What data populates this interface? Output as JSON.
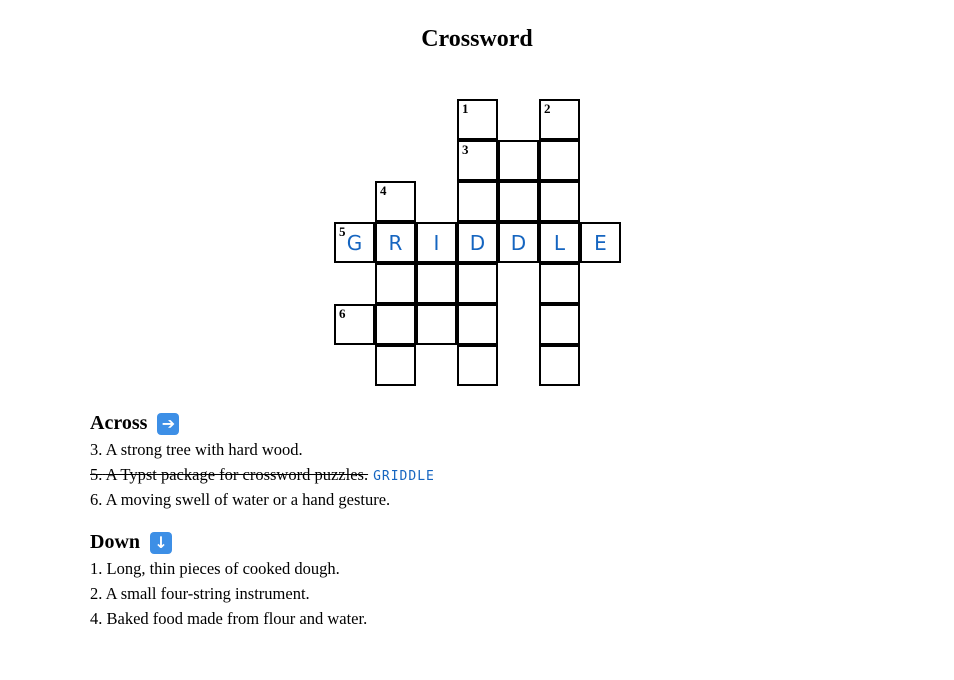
{
  "title": "Crossword",
  "grid": {
    "cells": [
      {
        "row": 0,
        "col": 3,
        "number": "1"
      },
      {
        "row": 0,
        "col": 5,
        "number": "2"
      },
      {
        "row": 1,
        "col": 3,
        "number": "3"
      },
      {
        "row": 1,
        "col": 4
      },
      {
        "row": 1,
        "col": 5
      },
      {
        "row": 2,
        "col": 1,
        "number": "4"
      },
      {
        "row": 2,
        "col": 3
      },
      {
        "row": 2,
        "col": 4
      },
      {
        "row": 2,
        "col": 5
      },
      {
        "row": 3,
        "col": 0,
        "number": "5",
        "letter": "G"
      },
      {
        "row": 3,
        "col": 1,
        "letter": "R"
      },
      {
        "row": 3,
        "col": 2,
        "letter": "I"
      },
      {
        "row": 3,
        "col": 3,
        "letter": "D"
      },
      {
        "row": 3,
        "col": 4,
        "letter": "D"
      },
      {
        "row": 3,
        "col": 5,
        "letter": "L"
      },
      {
        "row": 3,
        "col": 6,
        "letter": "E"
      },
      {
        "row": 4,
        "col": 1
      },
      {
        "row": 4,
        "col": 2
      },
      {
        "row": 4,
        "col": 3
      },
      {
        "row": 4,
        "col": 5
      },
      {
        "row": 5,
        "col": 0,
        "number": "6"
      },
      {
        "row": 5,
        "col": 1
      },
      {
        "row": 5,
        "col": 2
      },
      {
        "row": 5,
        "col": 3
      },
      {
        "row": 5,
        "col": 5
      },
      {
        "row": 6,
        "col": 1
      },
      {
        "row": 6,
        "col": 3
      },
      {
        "row": 6,
        "col": 5
      }
    ]
  },
  "across": {
    "heading": "Across",
    "icon": "right-arrow-icon",
    "icon_glyph": "➔",
    "clues": [
      {
        "number": "3.",
        "text": "A strong tree with hard wood.",
        "solved": false,
        "answer": ""
      },
      {
        "number": "5.",
        "text": "A Typst package for crossword puzzles.",
        "solved": true,
        "answer": "GRIDDLE"
      },
      {
        "number": "6.",
        "text": "A moving swell of water or a hand gesture.",
        "solved": false,
        "answer": ""
      }
    ]
  },
  "down": {
    "heading": "Down",
    "icon": "down-arrow-icon",
    "icon_glyph": "↓",
    "clues": [
      {
        "number": "1.",
        "text": "Long, thin pieces of cooked dough.",
        "solved": false,
        "answer": ""
      },
      {
        "number": "2.",
        "text": "A small four-string instrument.",
        "solved": false,
        "answer": ""
      },
      {
        "number": "4.",
        "text": "Baked food made from flour and water.",
        "solved": false,
        "answer": ""
      }
    ]
  },
  "colors": {
    "answer": "#1565c0",
    "badge": "#3d8fe6"
  }
}
